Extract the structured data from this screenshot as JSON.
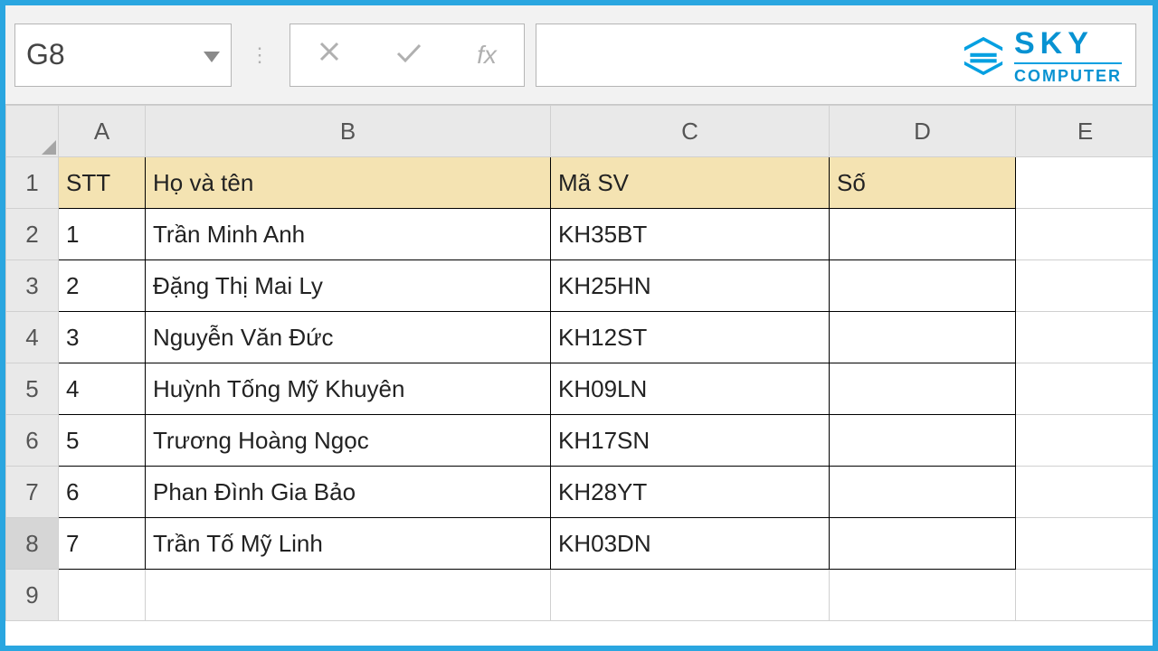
{
  "namebox": {
    "value": "G8"
  },
  "formula_bar": {
    "fx": "fx",
    "value": ""
  },
  "logo": {
    "line1": "SKY",
    "line2": "COMPUTER"
  },
  "columns": [
    "A",
    "B",
    "C",
    "D",
    "E"
  ],
  "headers": {
    "A": "STT",
    "B": "Họ và tên",
    "C": "Mã SV",
    "D": "Số"
  },
  "rows": [
    {
      "n": "1",
      "A": "1",
      "B": "Trần Minh Anh",
      "C": "KH35BT",
      "D": ""
    },
    {
      "n": "2",
      "A": "2",
      "B": "Đặng Thị Mai Ly",
      "C": "KH25HN",
      "D": ""
    },
    {
      "n": "3",
      "A": "3",
      "B": "Nguyễn Văn Đức",
      "C": "KH12ST",
      "D": ""
    },
    {
      "n": "4",
      "A": "4",
      "B": "Huỳnh Tống Mỹ Khuyên",
      "C": "KH09LN",
      "D": ""
    },
    {
      "n": "5",
      "A": "5",
      "B": "Trương Hoàng Ngọc",
      "C": "KH17SN",
      "D": ""
    },
    {
      "n": "6",
      "A": "6",
      "B": "Phan Đình Gia Bảo",
      "C": "KH28YT",
      "D": ""
    },
    {
      "n": "7",
      "A": "7",
      "B": "Trần Tố Mỹ Linh",
      "C": "KH03DN",
      "D": ""
    }
  ],
  "row_labels": [
    "1",
    "2",
    "3",
    "4",
    "5",
    "6",
    "7",
    "8",
    "9"
  ],
  "selected_row": "8"
}
